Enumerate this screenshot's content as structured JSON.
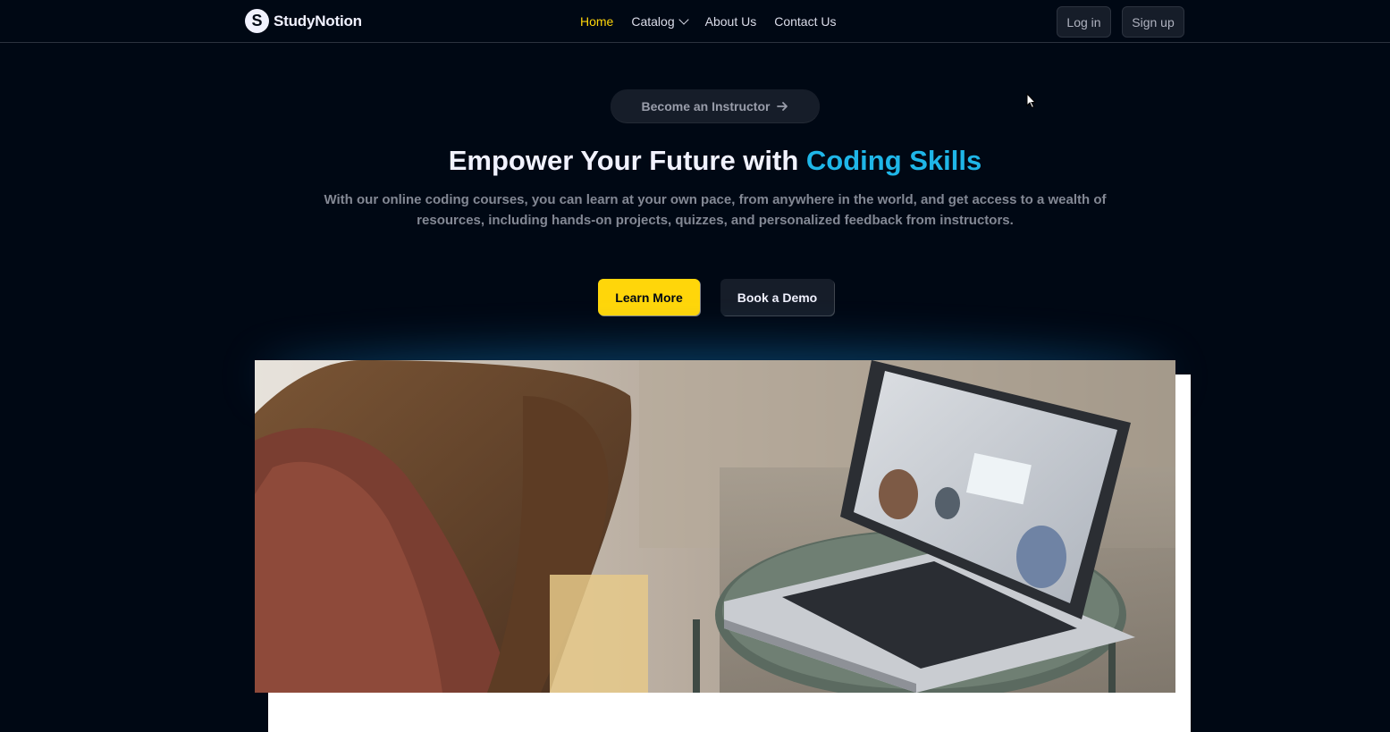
{
  "brand": {
    "name": "StudyNotion",
    "logo_letter": "S"
  },
  "nav": {
    "home": "Home",
    "catalog": "Catalog",
    "about": "About Us",
    "contact": "Contact Us"
  },
  "auth": {
    "login": "Log in",
    "signup": "Sign up"
  },
  "hero": {
    "instructor_label": "Become an Instructor",
    "headline_prefix": "Empower Your Future with ",
    "headline_highlight": "Coding Skills",
    "description": "With our online coding courses, you can learn at your own pace, from anywhere in the world, and get access to a wealth of resources, including hands-on projects, quizzes, and personalized feedback from instructors.",
    "learn_more": "Learn More",
    "book_demo": "Book a Demo"
  },
  "colors": {
    "background": "#000814",
    "accent_yellow": "#FFD60A",
    "highlight_blue": "#1FB6E8",
    "button_dark": "#161D29"
  },
  "icons": {
    "logo": "studynotion-logo-icon",
    "catalog_dropdown": "chevron-down-icon",
    "instructor_arrow": "arrow-right-icon",
    "pointer": "mouse-cursor-icon"
  }
}
